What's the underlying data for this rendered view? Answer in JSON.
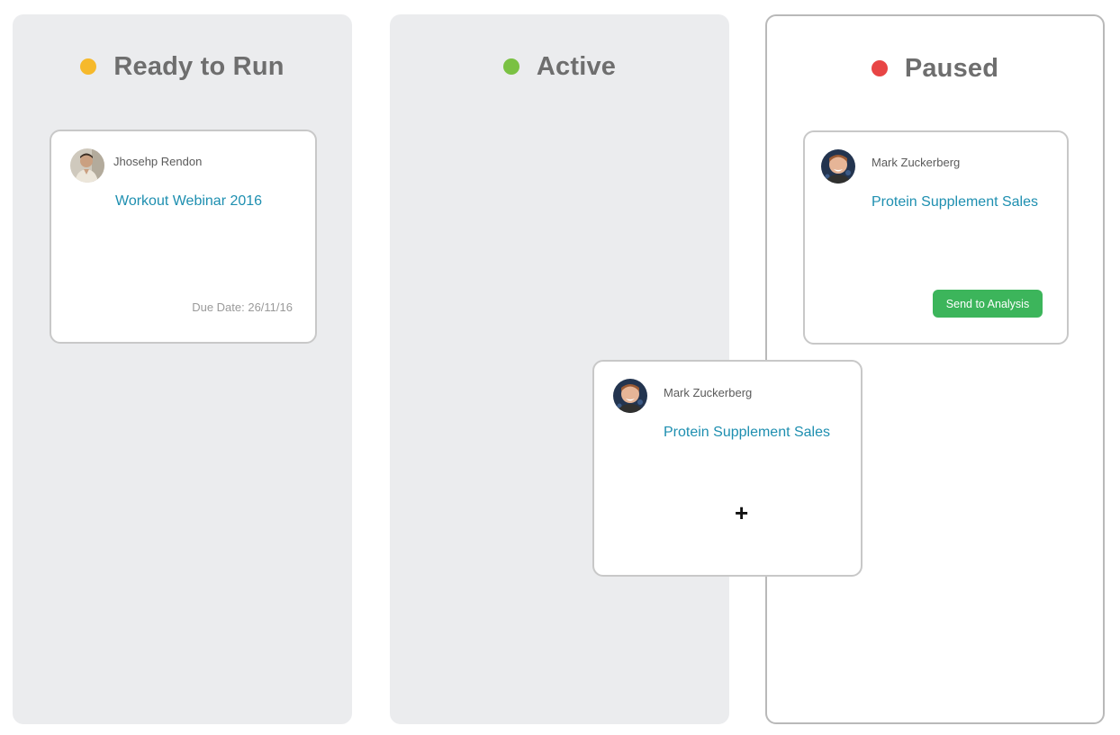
{
  "columns": {
    "ready": {
      "title": "Ready to Run",
      "dot_color": "#f6b92b"
    },
    "active": {
      "title": "Active",
      "dot_color": "#7ac143"
    },
    "paused": {
      "title": "Paused",
      "dot_color": "#e84545"
    }
  },
  "cards": {
    "ready_card": {
      "owner": "Jhosehp Rendon",
      "project": "Workout Webinar 2016",
      "due_date": "Due Date: 26/11/16",
      "avatar_icon": "user-photo-avatar"
    },
    "paused_card": {
      "owner": "Mark Zuckerberg",
      "project": "Protein Supplement Sales",
      "button_label": "Send to Analysis",
      "avatar_icon": "user-photo-avatar"
    },
    "dragging_card": {
      "owner": "Mark Zuckerberg",
      "project": "Protein Supplement Sales",
      "cursor_glyph": "+",
      "avatar_icon": "user-photo-avatar"
    }
  },
  "colors": {
    "column_bg": "#ebecee",
    "title_text": "#6e6e6e",
    "project_link": "#1e8fb0",
    "button_green": "#3cb55b"
  }
}
